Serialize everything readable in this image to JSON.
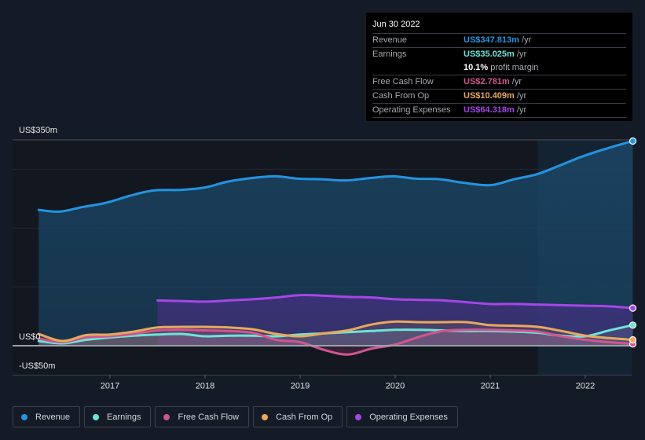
{
  "tooltip": {
    "date": "Jun 30 2022",
    "rows": [
      {
        "label": "Revenue",
        "value": "US$347.813m",
        "unit": " /yr",
        "color": "#2394df"
      },
      {
        "label": "Earnings",
        "value": "US$35.025m",
        "unit": " /yr",
        "color": "#6ce5d8"
      },
      {
        "label": "",
        "value": "10.1%",
        "unit": " profit margin",
        "color": "#ffffff"
      },
      {
        "label": "Free Cash Flow",
        "value": "US$2.781m",
        "unit": " /yr",
        "color": "#d1558f"
      },
      {
        "label": "Cash From Op",
        "value": "US$10.409m",
        "unit": " /yr",
        "color": "#e8a95c"
      },
      {
        "label": "Operating Expenses",
        "value": "US$64.318m",
        "unit": " /yr",
        "color": "#a646e8"
      }
    ]
  },
  "legend": [
    {
      "label": "Revenue",
      "color": "#2394df"
    },
    {
      "label": "Earnings",
      "color": "#6ce5d8"
    },
    {
      "label": "Free Cash Flow",
      "color": "#d1558f"
    },
    {
      "label": "Cash From Op",
      "color": "#e8a95c"
    },
    {
      "label": "Operating Expenses",
      "color": "#a646e8"
    }
  ],
  "chart_data": {
    "type": "area",
    "title": "",
    "xlabel": "",
    "ylabel": "",
    "y_tick_labels": [
      "US$350m",
      "US$0",
      "-US$50m"
    ],
    "ylim": [
      -50,
      350
    ],
    "xlim": [
      2016.0,
      2022.5
    ],
    "x_tick_labels": [
      "2017",
      "2018",
      "2019",
      "2020",
      "2021",
      "2022"
    ],
    "x_ticks": [
      2017,
      2018,
      2019,
      2020,
      2021,
      2022
    ],
    "grid": true,
    "highlight_from": 2021.5,
    "legend_position": "bottom-left",
    "series": [
      {
        "name": "Revenue",
        "color": "#2394df",
        "x": [
          2016.25,
          2016.47,
          2016.72,
          2016.96,
          2017.21,
          2017.46,
          2017.75,
          2018.0,
          2018.24,
          2018.49,
          2018.74,
          2018.98,
          2019.23,
          2019.48,
          2019.73,
          2019.98,
          2020.22,
          2020.47,
          2020.72,
          2021.0,
          2021.25,
          2021.5,
          2021.74,
          2021.99,
          2022.24,
          2022.5
        ],
        "values": [
          231,
          228,
          236,
          243,
          255,
          264,
          265,
          269,
          279,
          285,
          288,
          284,
          283,
          281,
          285,
          288,
          284,
          283,
          277,
          273,
          283,
          292,
          307,
          323,
          336,
          348
        ]
      },
      {
        "name": "Earnings",
        "color": "#6ce5d8",
        "x": [
          2016.25,
          2016.5,
          2016.75,
          2017.0,
          2017.25,
          2017.5,
          2017.75,
          2018.0,
          2018.25,
          2018.5,
          2018.75,
          2019.0,
          2019.25,
          2019.5,
          2019.75,
          2020.0,
          2020.25,
          2020.5,
          2020.75,
          2021.0,
          2021.25,
          2021.5,
          2021.75,
          2022.0,
          2022.25,
          2022.5
        ],
        "values": [
          8,
          4,
          10,
          14,
          17,
          19,
          20,
          16,
          17,
          17,
          16,
          19,
          21,
          23,
          25,
          27,
          27,
          26,
          25,
          25,
          24,
          22,
          17,
          16,
          26,
          35
        ]
      },
      {
        "name": "Free Cash Flow",
        "color": "#d1558f",
        "x": [
          2016.25,
          2016.5,
          2016.75,
          2017.0,
          2017.25,
          2017.5,
          2017.75,
          2018.0,
          2018.25,
          2018.5,
          2018.75,
          2019.0,
          2019.25,
          2019.5,
          2019.75,
          2020.0,
          2020.25,
          2020.5,
          2020.75,
          2021.0,
          2021.25,
          2021.5,
          2021.75,
          2022.0,
          2022.25,
          2022.5
        ],
        "values": [
          12,
          6,
          14,
          16,
          20,
          26,
          27,
          26,
          25,
          22,
          10,
          6,
          -7,
          -15,
          -5,
          2,
          15,
          25,
          27,
          27,
          26,
          24,
          16,
          10,
          6,
          3
        ]
      },
      {
        "name": "Cash From Op",
        "color": "#e8a95c",
        "x": [
          2016.25,
          2016.5,
          2016.75,
          2017.0,
          2017.25,
          2017.5,
          2017.75,
          2018.0,
          2018.25,
          2018.5,
          2018.75,
          2019.0,
          2019.25,
          2019.5,
          2019.75,
          2020.0,
          2020.25,
          2020.5,
          2020.75,
          2021.0,
          2021.25,
          2021.5,
          2021.75,
          2022.0,
          2022.25,
          2022.5
        ],
        "values": [
          20,
          8,
          18,
          19,
          24,
          31,
          32,
          32,
          31,
          28,
          20,
          16,
          21,
          26,
          36,
          41,
          40,
          40,
          40,
          35,
          34,
          32,
          25,
          17,
          13,
          10
        ]
      },
      {
        "name": "Operating Expenses",
        "color": "#a646e8",
        "x": [
          2017.5,
          2017.75,
          2018.0,
          2018.25,
          2018.5,
          2018.75,
          2019.0,
          2019.25,
          2019.5,
          2019.75,
          2020.0,
          2020.25,
          2020.5,
          2020.75,
          2021.0,
          2021.25,
          2021.5,
          2021.75,
          2022.0,
          2022.25,
          2022.5
        ],
        "values": [
          77,
          76,
          75,
          77,
          79,
          82,
          86,
          85,
          83,
          82,
          79,
          78,
          77,
          74,
          71,
          71,
          70,
          69,
          68,
          67,
          64
        ]
      }
    ]
  }
}
